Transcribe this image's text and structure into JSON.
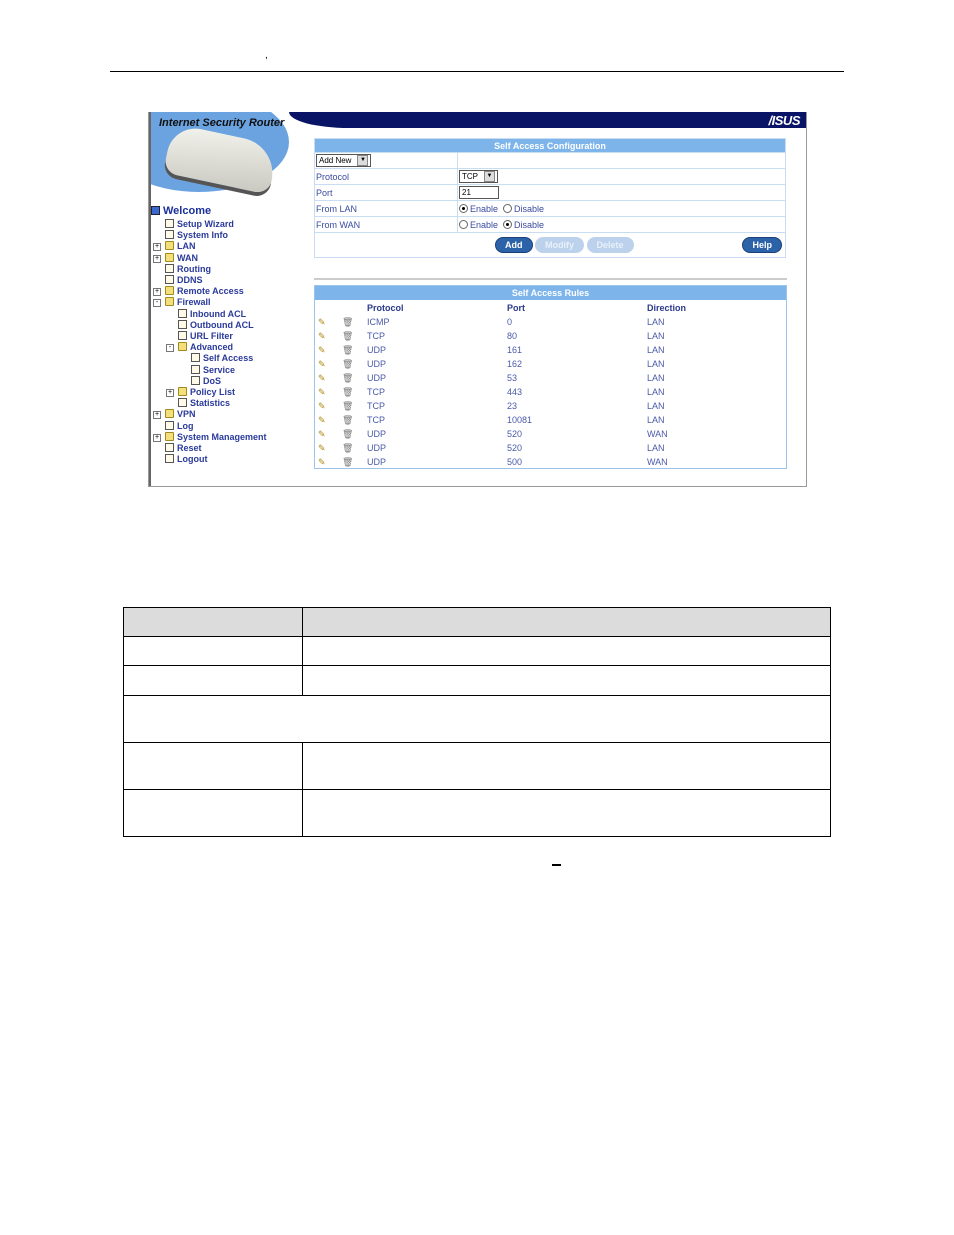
{
  "doc": {
    "header_mark": ","
  },
  "app": {
    "product_title": "Internet Security Router",
    "brand_logo": "/ISUS",
    "colors": {
      "topbar": "#0a1466",
      "table_header": "#7db5ea",
      "button": "#2c62a8",
      "link": "#2a3a9a"
    }
  },
  "sidebar": {
    "items": [
      {
        "label": "Welcome",
        "level": 0,
        "type": "pc",
        "top": true
      },
      {
        "label": "Setup Wizard",
        "level": 1,
        "type": "page"
      },
      {
        "label": "System Info",
        "level": 1,
        "type": "page"
      },
      {
        "label": "LAN",
        "level": 1,
        "type": "folder",
        "expander": "+"
      },
      {
        "label": "WAN",
        "level": 1,
        "type": "folder",
        "expander": "+"
      },
      {
        "label": "Routing",
        "level": 1,
        "type": "page"
      },
      {
        "label": "DDNS",
        "level": 1,
        "type": "page"
      },
      {
        "label": "Remote Access",
        "level": 1,
        "type": "folder",
        "expander": "+"
      },
      {
        "label": "Firewall",
        "level": 1,
        "type": "folder",
        "expander": "-"
      },
      {
        "label": "Inbound ACL",
        "level": 2,
        "type": "page"
      },
      {
        "label": "Outbound ACL",
        "level": 2,
        "type": "page"
      },
      {
        "label": "URL Filter",
        "level": 2,
        "type": "page"
      },
      {
        "label": "Advanced",
        "level": 2,
        "type": "folder",
        "expander": "-"
      },
      {
        "label": "Self Access",
        "level": 3,
        "type": "page"
      },
      {
        "label": "Service",
        "level": 3,
        "type": "page"
      },
      {
        "label": "DoS",
        "level": 3,
        "type": "page"
      },
      {
        "label": "Policy List",
        "level": 2,
        "type": "folder",
        "expander": "+"
      },
      {
        "label": "Statistics",
        "level": 2,
        "type": "page"
      },
      {
        "label": "VPN",
        "level": 1,
        "type": "folder",
        "expander": "+"
      },
      {
        "label": "Log",
        "level": 1,
        "type": "page"
      },
      {
        "label": "System Management",
        "level": 1,
        "type": "folder",
        "expander": "+"
      },
      {
        "label": "Reset",
        "level": 1,
        "type": "page"
      },
      {
        "label": "Logout",
        "level": 1,
        "type": "page"
      }
    ]
  },
  "config": {
    "title": "Self Access Configuration",
    "mode_select": "Add New",
    "protocol_label": "Protocol",
    "protocol_value": "TCP",
    "port_label": "Port",
    "port_value": "21",
    "from_lan_label": "From LAN",
    "from_wan_label": "From WAN",
    "enable_label": "Enable",
    "disable_label": "Disable",
    "from_lan": "Enable",
    "from_wan": "Disable",
    "buttons": {
      "add": "Add",
      "modify": "Modify",
      "delete": "Delete",
      "help": "Help"
    }
  },
  "rules": {
    "title": "Self Access Rules",
    "columns": [
      "Protocol",
      "Port",
      "Direction"
    ],
    "rows": [
      [
        "ICMP",
        "0",
        "LAN"
      ],
      [
        "TCP",
        "80",
        "LAN"
      ],
      [
        "UDP",
        "161",
        "LAN"
      ],
      [
        "UDP",
        "162",
        "LAN"
      ],
      [
        "UDP",
        "53",
        "LAN"
      ],
      [
        "TCP",
        "443",
        "LAN"
      ],
      [
        "TCP",
        "23",
        "LAN"
      ],
      [
        "TCP",
        "10081",
        "LAN"
      ],
      [
        "UDP",
        "520",
        "WAN"
      ],
      [
        "UDP",
        "520",
        "LAN"
      ],
      [
        "UDP",
        "500",
        "WAN"
      ]
    ],
    "icons": {
      "edit": "pencil-icon",
      "delete": "trash-icon"
    }
  }
}
